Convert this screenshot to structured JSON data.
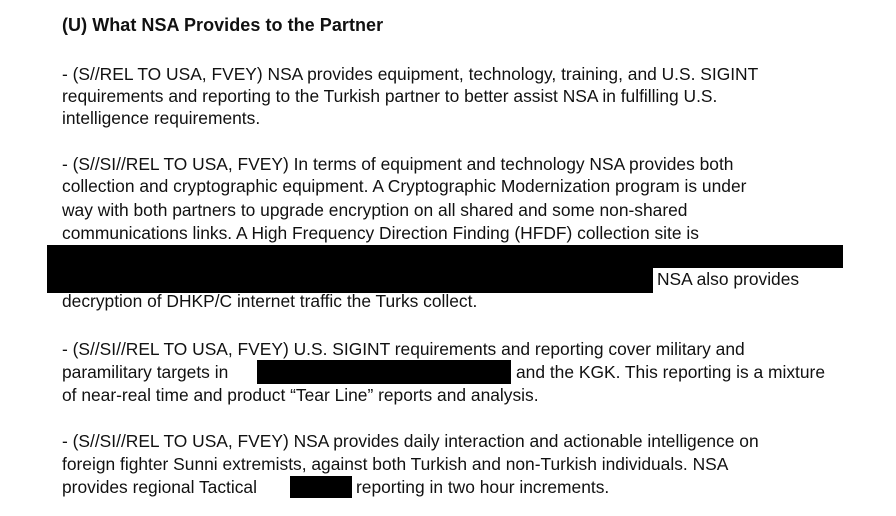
{
  "heading": "(U) What NSA Provides to the Partner",
  "paragraphs": [
    {
      "lines": [
        "- (S//REL TO USA, FVEY)  NSA provides equipment, technology, training, and U.S. SIGINT",
        "requirements and reporting to the Turkish partner to better assist NSA in fulfilling U.S.",
        "intelligence requirements."
      ]
    },
    {
      "lines": [
        "- (S//SI//REL TO USA, FVEY)  In terms of equipment and technology NSA provides both",
        "collection and cryptographic equipment.  A Cryptographic Modernization program is under",
        "way with both partners to upgrade encryption on all shared and some non-shared",
        "communications links.  A High Frequency Direction Finding (HFDF) collection site is",
        "NSA also provides",
        "decryption of DHKP/C internet traffic the Turks collect."
      ]
    },
    {
      "lines": [
        "- (S//SI//REL TO USA, FVEY)  U.S. SIGINT requirements and reporting cover military and",
        "paramilitary targets in",
        "and the KGK.  This reporting is a mixture",
        "of near-real time and product “Tear Line” reports and analysis."
      ]
    },
    {
      "lines": [
        "- (S//SI//REL TO USA, FVEY)  NSA provides daily interaction and actionable intelligence on",
        "foreign fighter Sunni extremists, against both Turkish and non-Turkish individuals.  NSA",
        "provides regional Tactical",
        "reporting in two hour increments."
      ]
    }
  ]
}
